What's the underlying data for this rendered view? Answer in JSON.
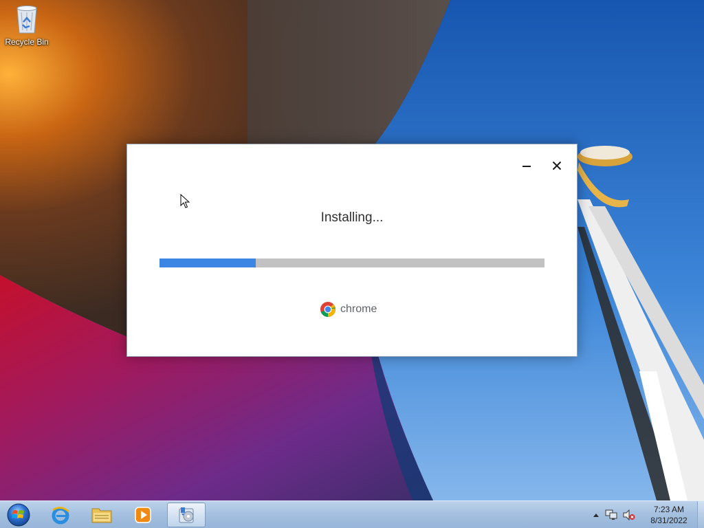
{
  "desktop": {
    "icons": [
      {
        "label": "Recycle Bin",
        "icon": "recycle-bin-icon"
      }
    ]
  },
  "installer": {
    "status_text": "Installing...",
    "progress": 0.25,
    "brand_name": "chrome",
    "buttons": {
      "minimize": "minimize-icon",
      "close": "close-icon"
    }
  },
  "taskbar": {
    "start_icon": "windows-start-orb-icon",
    "pinned": [
      {
        "name": "internet-explorer",
        "icon": "internet-explorer-icon"
      },
      {
        "name": "file-explorer",
        "icon": "folder-icon"
      },
      {
        "name": "media-player",
        "icon": "media-player-icon"
      },
      {
        "name": "chrome-installer",
        "icon": "installer-icon",
        "active": true
      }
    ],
    "tray_icons": [
      "show-hidden-icons-icon",
      "network-icon",
      "volume-muted-icon"
    ],
    "clock": {
      "time": "7:23 AM",
      "date": "8/31/2022"
    }
  },
  "colors": {
    "progress_fill": "#3a86e2",
    "progress_track": "#c2c2c2",
    "taskbar": "#a6c1e0"
  }
}
